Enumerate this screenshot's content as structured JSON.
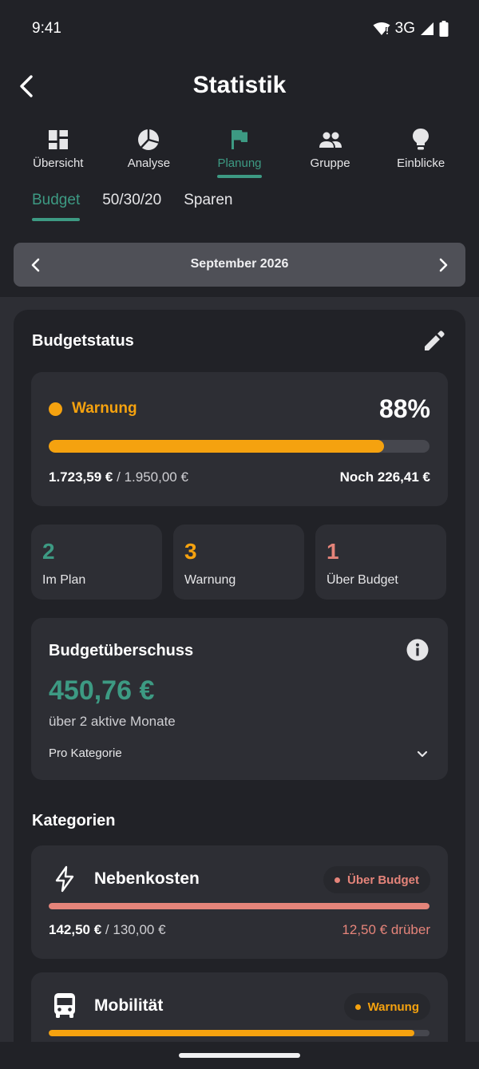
{
  "status_bar": {
    "time": "9:41",
    "network": "3G"
  },
  "app_bar": {
    "title": "Statistik"
  },
  "main_tabs": [
    {
      "label": "Übersicht",
      "icon": "dashboard-icon",
      "active": false
    },
    {
      "label": "Analyse",
      "icon": "pie-chart-icon",
      "active": false
    },
    {
      "label": "Planung",
      "icon": "flag-icon",
      "active": true
    },
    {
      "label": "Gruppe",
      "icon": "people-icon",
      "active": false
    },
    {
      "label": "Einblicke",
      "icon": "lightbulb-icon",
      "active": false
    }
  ],
  "sub_tabs": [
    {
      "label": "Budget",
      "active": true
    },
    {
      "label": "50/30/20",
      "active": false
    },
    {
      "label": "Sparen",
      "active": false
    }
  ],
  "month_selector": {
    "label": "September 2026"
  },
  "budget_status": {
    "title": "Budgetstatus",
    "status_label": "Warnung",
    "percent_label": "88%",
    "progress_fraction": 0.88,
    "spent": "1.723,59 €",
    "separator": "/",
    "total": "1.950,00 €",
    "remaining": "Noch 226,41 €"
  },
  "counters": [
    {
      "value": "2",
      "label": "Im Plan",
      "color": "#3d9a83"
    },
    {
      "value": "3",
      "label": "Warnung",
      "color": "#f5a20f"
    },
    {
      "value": "1",
      "label": "Über Budget",
      "color": "#e5847a"
    }
  ],
  "surplus": {
    "title": "Budgetüberschuss",
    "amount": "450,76 €",
    "subtitle": "über 2 aktive Monate",
    "per_category_label": "Pro Kategorie"
  },
  "categories_section": {
    "title": "Kategorien"
  },
  "categories": [
    {
      "name": "Nebenkosten",
      "icon": "lightning-icon",
      "badge": "Über Budget",
      "badge_color": "#e5847a",
      "spent": "142,50 €",
      "separator": "/",
      "budget": "130,00 €",
      "diff": "12,50 € drüber",
      "progress_fraction": 1.0
    },
    {
      "name": "Mobilität",
      "icon": "bus-icon",
      "badge": "Warnung",
      "badge_color": "#f5a20f",
      "progress_fraction": 0.96
    }
  ],
  "colors": {
    "accent": "#3d9a83",
    "warning": "#f5a20f",
    "over_budget": "#e5847a",
    "background": "#2d2e34",
    "surface": "#212227"
  }
}
